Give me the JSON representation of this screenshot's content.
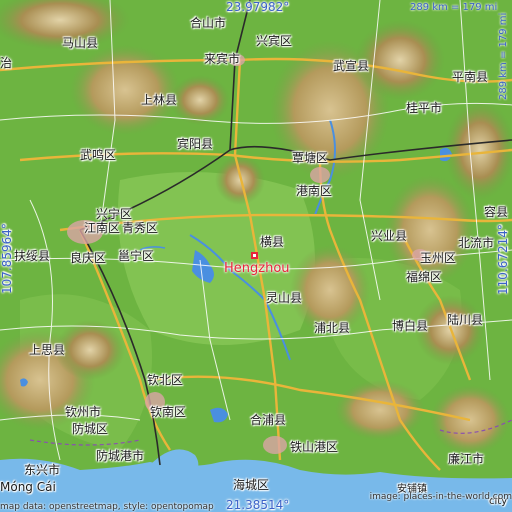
{
  "coordinates": {
    "top_lat": "23.97982°",
    "bottom_lat": "21.38514°",
    "left_lon": "107.85964°",
    "right_lon": "110.67214°"
  },
  "scale": {
    "horizontal": "289 km = 179 mi",
    "vertical": "289 km = 179 mi"
  },
  "highlight": {
    "name": "Hengzhou",
    "marker_color": "#e8243b"
  },
  "places": [
    {
      "id": "heshan-shi",
      "label": "合山市"
    },
    {
      "id": "xingbin-qu",
      "label": "兴宾区"
    },
    {
      "id": "laibin-shi",
      "label": "来宾市"
    },
    {
      "id": "mashan-xian",
      "label": "马山县"
    },
    {
      "id": "wuxuan-xian",
      "label": "武宣县"
    },
    {
      "id": "pingnan-xian",
      "label": "平南县"
    },
    {
      "id": "shanglin-xian",
      "label": "上林县"
    },
    {
      "id": "guiping-shi",
      "label": "桂平市"
    },
    {
      "id": "binyang-xian",
      "label": "宾阳县"
    },
    {
      "id": "wuming-qu",
      "label": "武鸣区"
    },
    {
      "id": "tantang-qu",
      "label": "覃塘区"
    },
    {
      "id": "gangnan-qu",
      "label": "港南区"
    },
    {
      "id": "xingning-qu",
      "label": "兴宁区"
    },
    {
      "id": "jiangnan-qu",
      "label": "江南区"
    },
    {
      "id": "qingxiu-qu",
      "label": "青秀区"
    },
    {
      "id": "rong-xian",
      "label": "容县"
    },
    {
      "id": "heng-xian",
      "label": "横县"
    },
    {
      "id": "xingye-xian",
      "label": "兴业县"
    },
    {
      "id": "beiliu-shi",
      "label": "北流市"
    },
    {
      "id": "fusui-xian",
      "label": "扶绥县"
    },
    {
      "id": "liangqing-qu",
      "label": "良庆区"
    },
    {
      "id": "yongning-qu",
      "label": "邕宁区"
    },
    {
      "id": "yuzhou-qu",
      "label": "玉州区"
    },
    {
      "id": "fumian-qu",
      "label": "福绵区"
    },
    {
      "id": "lingshan-xian",
      "label": "灵山县"
    },
    {
      "id": "pubei-xian",
      "label": "浦北县"
    },
    {
      "id": "bobai-xian",
      "label": "博白县"
    },
    {
      "id": "luchuan-xian",
      "label": "陆川县"
    },
    {
      "id": "shangsi-xian",
      "label": "上思县"
    },
    {
      "id": "qinbei-qu",
      "label": "钦北区"
    },
    {
      "id": "qinzhou-shi",
      "label": "钦州市"
    },
    {
      "id": "qinnan-qu",
      "label": "钦南区"
    },
    {
      "id": "fangcheng-qu",
      "label": "防城区"
    },
    {
      "id": "hepu-xian",
      "label": "合浦县"
    },
    {
      "id": "fangchenggang-shi",
      "label": "防城港市"
    },
    {
      "id": "dongxing-shi",
      "label": "东兴市"
    },
    {
      "id": "tieshangang-qu",
      "label": "铁山港区"
    },
    {
      "id": "lianjiang-shi",
      "label": "廉江市"
    },
    {
      "id": "haicheng-qu",
      "label": "海城区"
    },
    {
      "id": "anpu-zhen",
      "label": "安铺镇"
    },
    {
      "id": "mong-cai",
      "label": "Móng Cái"
    },
    {
      "id": "zhi",
      "label": "治"
    },
    {
      "id": "city",
      "label": "city"
    }
  ],
  "attribution": {
    "left": "map data: openstreetmap, style: opentopomap",
    "right": "image: places-in-the-world.com"
  },
  "colors": {
    "land_light": "#7fbf4f",
    "land_dark": "#3f8f2f",
    "hills": "#c9b27a",
    "water": "#3d7fd8",
    "sea": "#72b4e8",
    "road_major": "#e9b53a",
    "road_minor": "#ffffff",
    "rail": "#2a2a2a",
    "coord_text": "#3b62c8"
  }
}
